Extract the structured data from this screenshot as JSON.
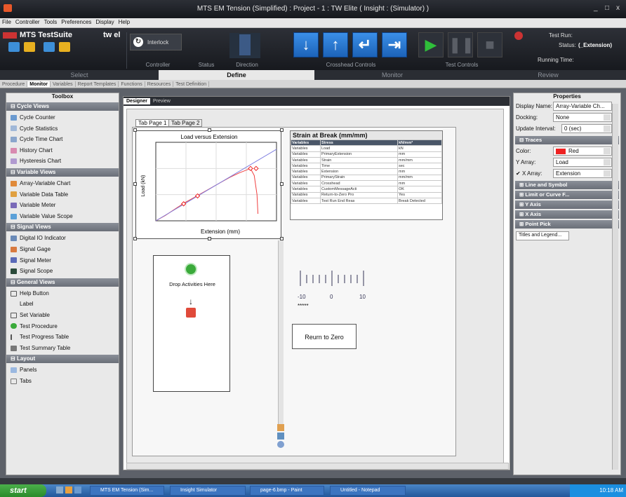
{
  "window": {
    "title": "MTS EM Tension (Simplified) : Project - 1 : TW Elite ( Insight : (Simulator) )",
    "controls": [
      "_",
      "□",
      "x"
    ]
  },
  "menu": [
    "File",
    "Controller",
    "Tools",
    "Preferences",
    "Display",
    "Help"
  ],
  "brand": {
    "name": "MTS TestSuite",
    "edition": "tw el"
  },
  "ribbon": {
    "interlock_label": "Interlock",
    "groups": {
      "controller": "Controller",
      "status": "Status",
      "direction": "Direction",
      "crosshead": "Crosshead Controls",
      "test_controls": "Test Controls"
    },
    "run": {
      "test_run_label": "Test Run:",
      "status_label": "Status:",
      "status_value": "(_Extension)",
      "running_time_label": "Running Time:"
    }
  },
  "nav_tabs": [
    "Select",
    "Define",
    "Monitor",
    "Review"
  ],
  "sub_tabs": [
    "Procedure",
    "Monitor",
    "Variables",
    "Report Templates",
    "Functions",
    "Resources",
    "Test Definition"
  ],
  "toolbox": {
    "title": "Toolbox",
    "categories": [
      {
        "name": "Cycle Views",
        "items": [
          "Cycle Counter",
          "Cycle Statistics",
          "Cycle Time Chart",
          "History Chart",
          "Hysteresis Chart"
        ]
      },
      {
        "name": "Variable Views",
        "items": [
          "Array-Variable Chart",
          "Variable Data Table",
          "Variable Meter",
          "Variable Value Scope"
        ]
      },
      {
        "name": "Signal Views",
        "items": [
          "Digital IO Indicator",
          "Signal Gage",
          "Signal Meter",
          "Signal Scope"
        ]
      },
      {
        "name": "General Views",
        "items": [
          "Help Button",
          "Label",
          "Set Variable",
          "Test Procedure",
          "Test Progress Table",
          "Test Summary Table"
        ]
      },
      {
        "name": "Layout",
        "items": [
          "Panels",
          "Tabs"
        ]
      }
    ]
  },
  "designer": {
    "tabs": [
      "Designer",
      "Preview"
    ],
    "page_tabs": [
      "Tab Page 1",
      "Tab Page 2"
    ],
    "chart_title": "Load versus Extension",
    "table_title": "Strain at Break (mm/mm)",
    "table_headers": [
      "Variables",
      "Stress",
      "kN/mm²"
    ],
    "table_rows": [
      [
        "Variables",
        "Load",
        "kN"
      ],
      [
        "Variables",
        "PrimaryExtension",
        "mm"
      ],
      [
        "Variables",
        "Strain",
        "mm/mm"
      ],
      [
        "Variables",
        "Time",
        "sec"
      ],
      [
        "Variables",
        "Extension",
        "mm"
      ],
      [
        "Variables",
        "PrimaryStrain",
        "mm/mm"
      ],
      [
        "Variables",
        "Crosshead",
        "mm"
      ],
      [
        "Variables",
        "CustomMessageActi",
        "OK"
      ],
      [
        "Variables",
        "Return-to-Zero Pro",
        "Yes"
      ],
      [
        "Variables",
        "Test Run End Reas",
        "Break Detected"
      ]
    ],
    "drop_text": "Drop Activities Here",
    "scale_labels": [
      "-10",
      "0",
      "10"
    ],
    "scale_readout": "*****",
    "rz_button": "Reurn to Zero"
  },
  "chart_data": {
    "type": "line",
    "title": "Load versus Extension",
    "xlabel": "Extension (mm)",
    "ylabel": "Load (kN)",
    "series": [
      {
        "name": "",
        "color": "#f04040",
        "x": [
          0,
          1,
          2,
          3,
          4,
          5,
          6,
          7,
          8,
          9,
          10.2,
          10.6,
          10.9,
          11.0
        ],
        "y": [
          0,
          0.6,
          1.3,
          2.0,
          2.6,
          3.2,
          3.8,
          4.4,
          5.0,
          5.5,
          6.0,
          5.2,
          3.0,
          0.8
        ]
      },
      {
        "name": "",
        "color": "#7f7fe0",
        "x": [
          0,
          13
        ],
        "y": [
          0,
          8.2
        ]
      }
    ],
    "markers": {
      "x": [
        3,
        4.5,
        10.2,
        10.8
      ],
      "y": [
        1.95,
        2.85,
        6.0,
        6.0
      ]
    },
    "xlim": [
      0,
      13
    ],
    "ylim": [
      0,
      9
    ],
    "grid": true,
    "x_ticks": [
      "",
      "",
      "",
      ""
    ],
    "y_ticks": [
      "",
      "",
      ""
    ]
  },
  "properties": {
    "title": "Properties",
    "display_name_label": "Display Name:",
    "display_name_value": "Array-Variable Ch...",
    "docking_label": "Docking:",
    "docking_value": "None",
    "update_label": "Update Interval:",
    "update_value": "0 (sec)",
    "traces": "Traces",
    "color_label": "Color:",
    "color_value": "Red",
    "yarray_label": "Y Array:",
    "yarray_value": "Load",
    "xarray_label": "X Array:",
    "xarray_value": "Extension",
    "sections": [
      "Line and Symbol",
      "Limit or Curve F...",
      "Y Axis",
      "X Axis",
      "Point Pick"
    ],
    "titles_button": "Titles and Legend..."
  },
  "taskbar": {
    "start": "start",
    "tasks": [
      "MTS EM Tension (Sim...",
      "Insight Simulator",
      "page-6.bmp - Paint",
      "Untitled - Notepad"
    ],
    "clock": "10:18 AM"
  },
  "colors": {
    "accent_blue": "#2a78d2",
    "play_green": "#2fbf3a",
    "trace_red": "#f04040",
    "trace_blue": "#7f7fe0"
  }
}
